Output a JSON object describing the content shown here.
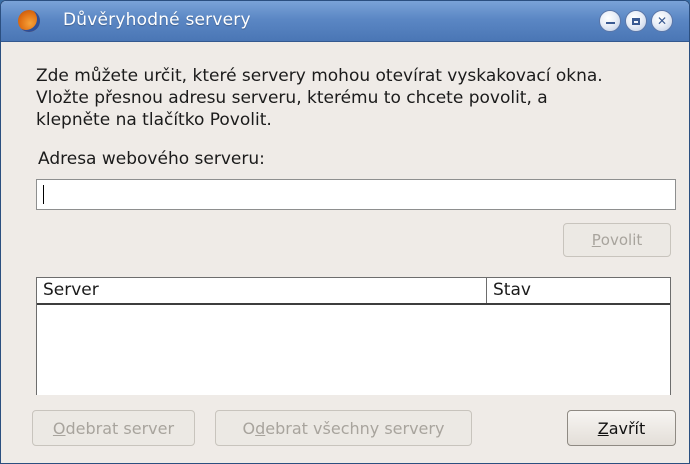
{
  "window": {
    "title": "Důvěryhodné servery",
    "icon": "firefox-icon"
  },
  "dialog": {
    "description_lines": [
      "Zde můžete určit, které servery mohou otevírat vyskakovací okna.",
      "Vložte přesnou adresu serveru, kterému to chcete povolit, a",
      "klepněte na tlačítko Povolit."
    ],
    "address_label": "Adresa webového serveru:",
    "address_value": "",
    "allow_button": {
      "mnemonic": "P",
      "rest": "ovolit",
      "enabled": false
    },
    "table": {
      "columns": [
        "Server",
        "Stav"
      ],
      "rows": []
    },
    "remove_button": {
      "mnemonic": "O",
      "rest": "debrat server",
      "enabled": false
    },
    "remove_all_button": {
      "pre": "O",
      "mnemonic": "d",
      "rest": "ebrat všechny servery",
      "enabled": false
    },
    "close_button": {
      "mnemonic": "Z",
      "rest": "avřít",
      "enabled": true
    }
  },
  "colors": {
    "titlebar": "#5b87c4",
    "dialog_bg": "#efebe7",
    "disabled_text": "#a8a49d"
  }
}
